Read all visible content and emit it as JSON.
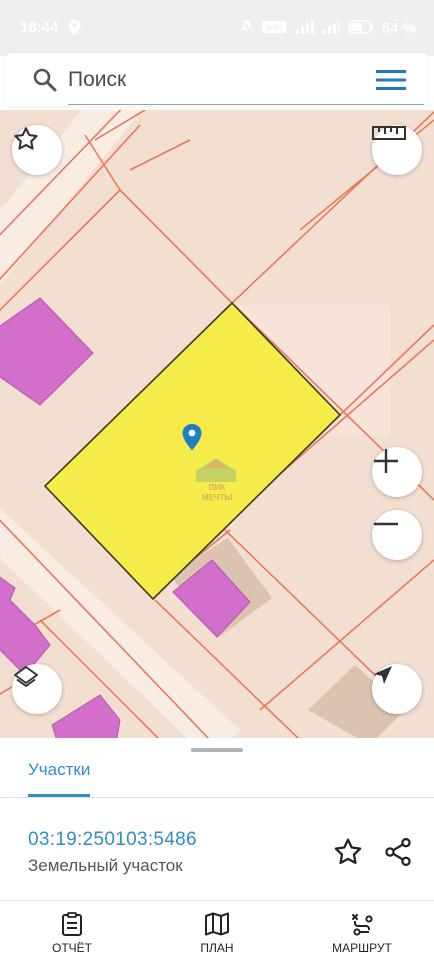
{
  "status_bar": {
    "time": "18:44",
    "battery_percent": "54 %",
    "icons": [
      "location-icon",
      "mute-icon",
      "wifi-icon",
      "4g-signal-icon",
      "signal-icon",
      "battery-icon"
    ]
  },
  "search": {
    "placeholder": "Поиск"
  },
  "map": {
    "watermark_line1": "ПИК",
    "watermark_line2": "МЕЧТЫ",
    "colors": {
      "background": "#f3dfd1",
      "parcel_border": "#e8785a",
      "selected_parcel": "#f5ec4a",
      "building": "#d26fca",
      "marker": "#1e7fc4"
    },
    "buttons": [
      "favorite-icon",
      "ruler-icon",
      "zoom-in-icon",
      "zoom-out-icon",
      "layers-icon",
      "locate-icon"
    ]
  },
  "sheet": {
    "tab_label": "Участки",
    "parcel_number": "03:19:250103:5486",
    "parcel_type": "Земельный участок",
    "accent_color": "#2e8fc7"
  },
  "bottom_nav": {
    "items": [
      {
        "label": "ОТЧЁТ",
        "icon": "report-icon"
      },
      {
        "label": "ПЛАН",
        "icon": "map-plan-icon"
      },
      {
        "label": "МАРШРУТ",
        "icon": "route-icon"
      }
    ]
  }
}
